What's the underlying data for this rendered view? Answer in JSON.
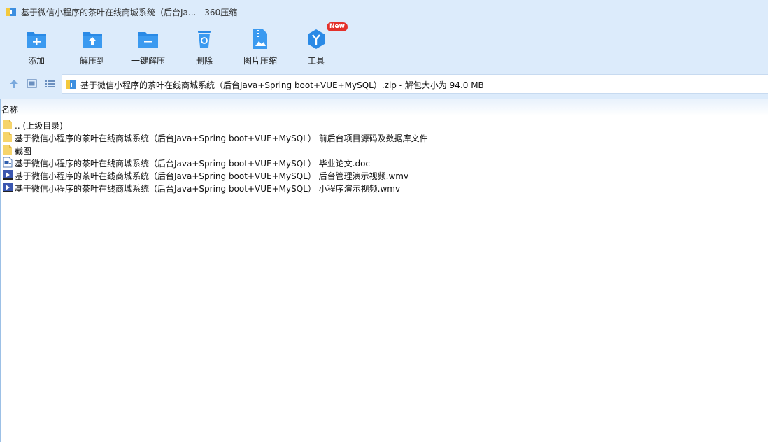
{
  "window": {
    "title": "基于微信小程序的茶叶在线商城系统（后台Ja... - 360压缩"
  },
  "toolbar": {
    "items": [
      {
        "label": "添加",
        "icon": "add-icon"
      },
      {
        "label": "解压到",
        "icon": "extract-to-icon"
      },
      {
        "label": "一键解压",
        "icon": "one-click-extract-icon"
      },
      {
        "label": "删除",
        "icon": "delete-icon"
      },
      {
        "label": "图片压缩",
        "icon": "image-compress-icon"
      },
      {
        "label": "工具",
        "icon": "tools-icon",
        "badge": "New"
      }
    ]
  },
  "nav": {
    "path": "基于微信小程序的茶叶在线商城系统（后台Java+Spring boot+VUE+MySQL）.zip - 解包大小为 94.0 MB"
  },
  "list": {
    "column_name": "名称",
    "files": [
      {
        "name": ".. (上级目录)",
        "type": "folder"
      },
      {
        "name": "基于微信小程序的茶叶在线商城系统（后台Java+Spring boot+VUE+MySQL） 前后台项目源码及数据库文件",
        "type": "folder"
      },
      {
        "name": "截图",
        "type": "folder"
      },
      {
        "name": "基于微信小程序的茶叶在线商城系统（后台Java+Spring boot+VUE+MySQL） 毕业论文.doc",
        "type": "doc"
      },
      {
        "name": "基于微信小程序的茶叶在线商城系统（后台Java+Spring boot+VUE+MySQL） 后台管理演示视频.wmv",
        "type": "video"
      },
      {
        "name": "基于微信小程序的茶叶在线商城系统（后台Java+Spring boot+VUE+MySQL） 小程序演示视频.wmv",
        "type": "video"
      }
    ]
  },
  "colors": {
    "chrome_bg": "#dcebfb",
    "icon_blue": "#2a8ae6",
    "badge_red": "#e4312b",
    "folder_yellow": "#f6d46b"
  }
}
